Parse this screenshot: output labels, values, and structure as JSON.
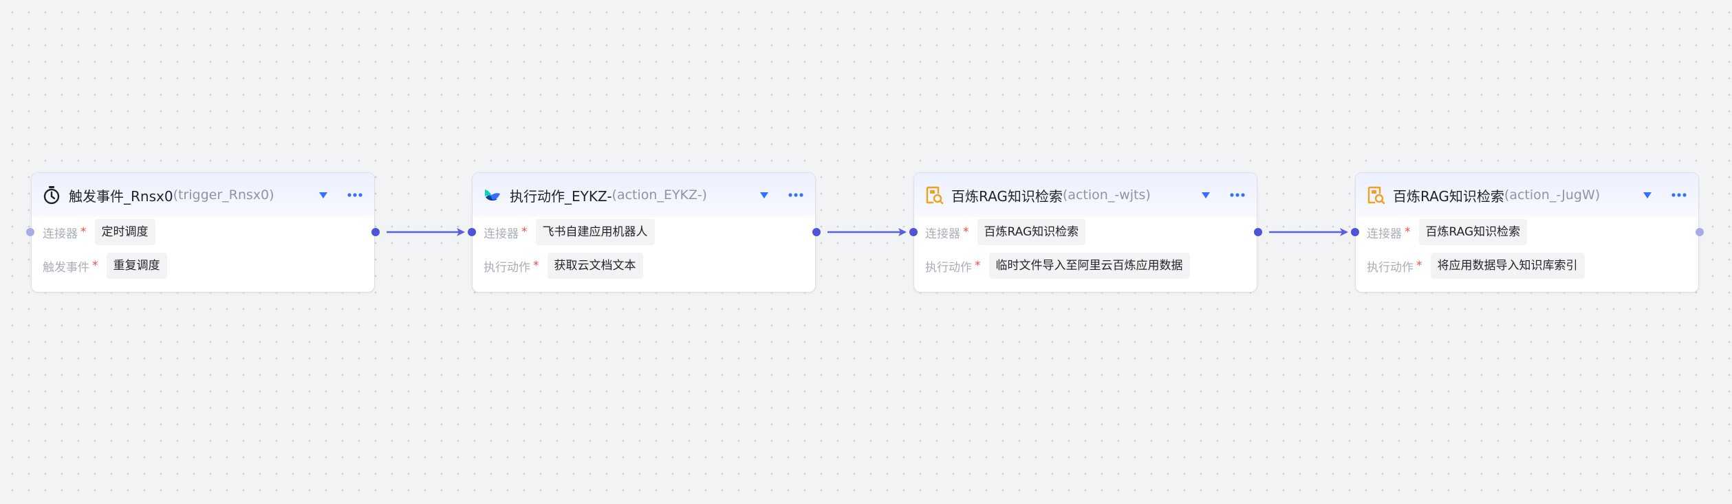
{
  "nodes": [
    {
      "title": "触发事件_Rnsx0",
      "subtitle": "(trigger_Rnsx0)",
      "icon": "stopwatch-icon",
      "rows": [
        {
          "label": "连接器",
          "required": "*",
          "value": "定时调度"
        },
        {
          "label": "触发事件",
          "required": "*",
          "value": "重复调度"
        }
      ]
    },
    {
      "title": "执行动作_EYKZ-",
      "subtitle": "(action_EYKZ-)",
      "icon": "feishu-bot-icon",
      "rows": [
        {
          "label": "连接器",
          "required": "*",
          "value": "飞书自建应用机器人"
        },
        {
          "label": "执行动作",
          "required": "*",
          "value": "获取云文档文本"
        }
      ]
    },
    {
      "title": "百炼RAG知识检索",
      "subtitle": "(action_-wjts)",
      "icon": "knowledge-search-icon",
      "rows": [
        {
          "label": "连接器",
          "required": "*",
          "value": "百炼RAG知识检索"
        },
        {
          "label": "执行动作",
          "required": "*",
          "value": "临时文件导入至阿里云百炼应用数据"
        }
      ]
    },
    {
      "title": "百炼RAG知识检索",
      "subtitle": "(action_-JugW)",
      "icon": "knowledge-search-icon",
      "rows": [
        {
          "label": "连接器",
          "required": "*",
          "value": "百炼RAG知识检索"
        },
        {
          "label": "执行动作",
          "required": "*",
          "value": "将应用数据导入知识库索引"
        }
      ]
    }
  ],
  "colors": {
    "accent": "#4e53d9",
    "required": "#f54a45",
    "header_gradient": "#eceffe",
    "knowledge_icon": "#f0a020"
  }
}
